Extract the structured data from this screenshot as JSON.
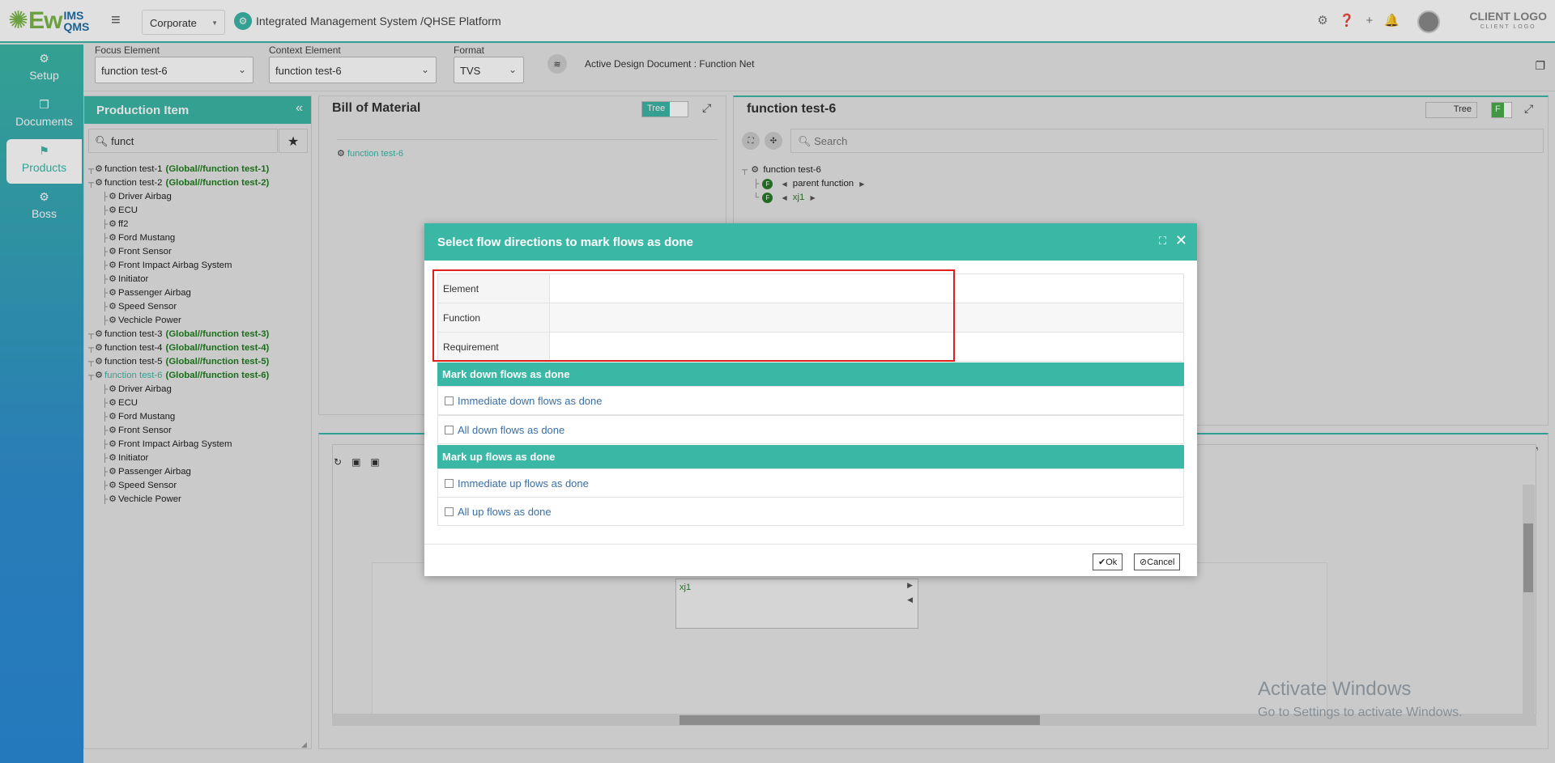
{
  "header": {
    "logo_text": "Ew",
    "logo_sub_top": "IMS",
    "logo_sub_bottom": "QMS",
    "org_select": "Corporate",
    "platform_title": "Integrated Management System /QHSE Platform",
    "client_logo": "CLIENT LOGO",
    "client_logo_sub": "CLIENT LOGO",
    "icons": [
      "gear-icon",
      "help-icon",
      "plus-icon",
      "bell-icon",
      "avatar"
    ]
  },
  "sidebar": {
    "items": [
      {
        "label": "Setup",
        "icon": "gears-icon",
        "active": false
      },
      {
        "label": "Documents",
        "icon": "documents-icon",
        "active": false
      },
      {
        "label": "Products",
        "icon": "flag-icon",
        "active": true
      },
      {
        "label": "Boss",
        "icon": "gears-icon",
        "active": false
      }
    ]
  },
  "toolbar": {
    "focus_label": "Focus Element",
    "focus_value": "function test-6",
    "context_label": "Context Element",
    "context_value": "function test-6",
    "format_label": "Format",
    "format_value": "TVS",
    "active_doc": "Active Design Document : Function Net"
  },
  "production": {
    "title": "Production Item",
    "search_value": "funct",
    "tree": [
      {
        "name": "function test-1",
        "global": "(Global//function test-1)",
        "level": 0,
        "selected": false
      },
      {
        "name": "function test-2",
        "global": "(Global//function test-2)",
        "level": 0,
        "selected": false
      },
      {
        "name": "Driver Airbag",
        "global": "",
        "level": 1,
        "selected": false
      },
      {
        "name": "ECU",
        "global": "",
        "level": 1,
        "selected": false
      },
      {
        "name": "ff2",
        "global": "",
        "level": 1,
        "selected": false
      },
      {
        "name": "Ford Mustang",
        "global": "",
        "level": 1,
        "selected": false
      },
      {
        "name": "Front Sensor",
        "global": "",
        "level": 1,
        "selected": false
      },
      {
        "name": "Front Impact Airbag System",
        "global": "",
        "level": 1,
        "selected": false
      },
      {
        "name": "Initiator",
        "global": "",
        "level": 1,
        "selected": false
      },
      {
        "name": "Passenger Airbag",
        "global": "",
        "level": 1,
        "selected": false
      },
      {
        "name": "Speed Sensor",
        "global": "",
        "level": 1,
        "selected": false
      },
      {
        "name": "Vechicle Power",
        "global": "",
        "level": 1,
        "selected": false
      },
      {
        "name": "function test-3",
        "global": "(Global//function test-3)",
        "level": 0,
        "selected": false
      },
      {
        "name": "function test-4",
        "global": "(Global//function test-4)",
        "level": 0,
        "selected": false
      },
      {
        "name": "function test-5",
        "global": "(Global//function test-5)",
        "level": 0,
        "selected": false
      },
      {
        "name": "function test-6",
        "global": "(Global//function test-6)",
        "level": 0,
        "selected": true
      },
      {
        "name": "Driver Airbag",
        "global": "",
        "level": 1,
        "selected": false
      },
      {
        "name": "ECU",
        "global": "",
        "level": 1,
        "selected": false
      },
      {
        "name": "Ford Mustang",
        "global": "",
        "level": 1,
        "selected": false
      },
      {
        "name": "Front Sensor",
        "global": "",
        "level": 1,
        "selected": false
      },
      {
        "name": "Front Impact Airbag System",
        "global": "",
        "level": 1,
        "selected": false
      },
      {
        "name": "Initiator",
        "global": "",
        "level": 1,
        "selected": false
      },
      {
        "name": "Passenger Airbag",
        "global": "",
        "level": 1,
        "selected": false
      },
      {
        "name": "Speed Sensor",
        "global": "",
        "level": 1,
        "selected": false
      },
      {
        "name": "Vechicle Power",
        "global": "",
        "level": 1,
        "selected": false
      }
    ]
  },
  "bom": {
    "title": "Bill of Material",
    "toggle_label": "Tree",
    "root": "function test-6"
  },
  "function_panel": {
    "title": "function test-6",
    "toggle_label": "Tree",
    "badge": "F",
    "search_placeholder": "Search",
    "tree_root": "function test-6",
    "children": [
      "parent function",
      "xj1"
    ]
  },
  "canvas": {
    "node_label": "xj1",
    "watermark_title": "Activate Windows",
    "watermark_sub": "Go to Settings to activate Windows."
  },
  "dialog": {
    "title": "Select flow directions to mark flows as done",
    "rows": [
      {
        "label": "Element",
        "value": ""
      },
      {
        "label": "Function",
        "value": ""
      },
      {
        "label": "Requirement",
        "value": ""
      }
    ],
    "down_heading": "Mark down flows as done",
    "down_options": [
      "Immediate down flows as done",
      "All down flows as done"
    ],
    "up_heading": "Mark up flows as done",
    "up_options": [
      "Immediate up flows as done",
      "All up flows as done"
    ],
    "ok_label": "Ok",
    "cancel_label": "Cancel"
  }
}
